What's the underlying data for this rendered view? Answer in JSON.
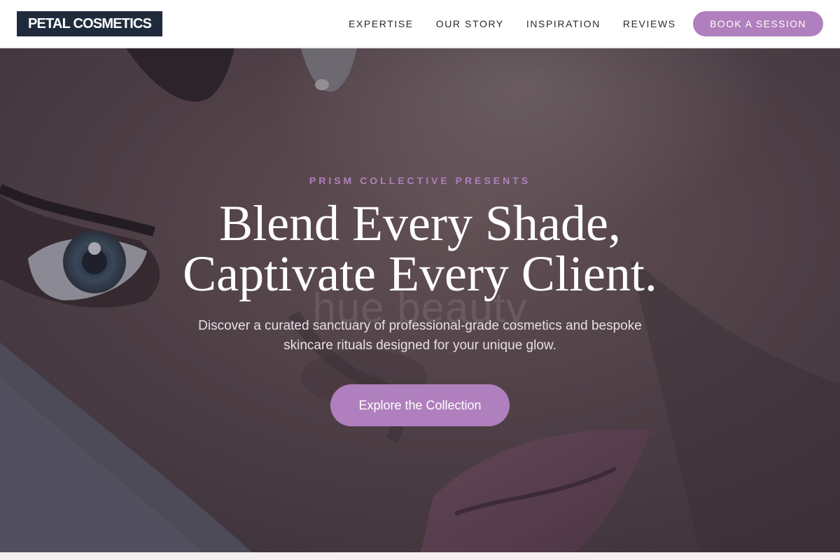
{
  "brand": {
    "logo_text": "PETAL COSMETICS"
  },
  "nav": {
    "items": [
      {
        "label": "EXPERTISE"
      },
      {
        "label": "OUR STORY"
      },
      {
        "label": "INSPIRATION"
      },
      {
        "label": "REVIEWS"
      }
    ],
    "cta_label": "BOOK A SESSION"
  },
  "hero": {
    "kicker": "PRISM COLLECTIVE PRESENTS",
    "headline_line1": "Blend Every Shade,",
    "headline_line2": "Captivate Every Client.",
    "watermark": "hue beauty",
    "subcopy": "Discover a curated sanctuary of professional-grade cosmetics and bespoke skincare rituals designed for your unique glow.",
    "cta_label": "Explore the Collection"
  },
  "colors": {
    "accent": "#b07fbd",
    "logo_bg": "#1f2b3d",
    "overlay": "#302a38"
  }
}
